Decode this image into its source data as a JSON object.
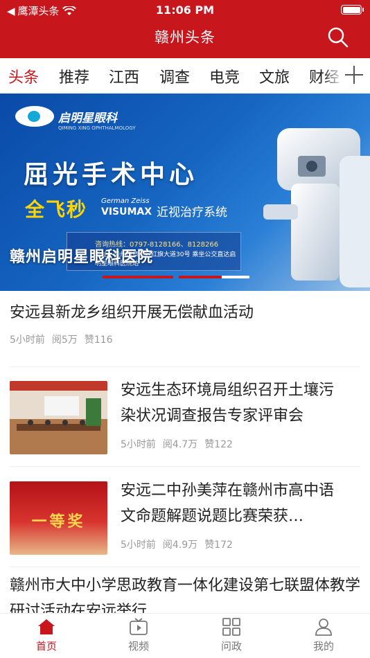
{
  "status_bar": {
    "back_app": "鹰潭头条",
    "time": "11:06 PM"
  },
  "header": {
    "title": "赣州头条"
  },
  "tabs": [
    {
      "label": "头条",
      "active": true
    },
    {
      "label": "推荐",
      "active": false
    },
    {
      "label": "江西",
      "active": false
    },
    {
      "label": "调查",
      "active": false
    },
    {
      "label": "电竞",
      "active": false
    },
    {
      "label": "文旅",
      "active": false
    },
    {
      "label": "财经",
      "active": false
    }
  ],
  "banner": {
    "logo_text": "启明星眼科",
    "logo_sub": "QIMING XING OPHTHALMOLOGY",
    "headline": "屈光手术中心",
    "subhead": "全飞秒",
    "brand_small": "German Zeiss",
    "brand": "VISUMAX",
    "system": "近视治疗系统",
    "contact": "咨询热线：0797-8128166、8128266",
    "address": "地址：赣州市章贡区红旗大道30号 乘坐公交直达启明星眼科医院站",
    "caption": "赣州启明星眼科医院",
    "slide_count": 3,
    "active_slide": 2
  },
  "feed": [
    {
      "title": "安远县新龙乡组织开展无偿献血活动",
      "time": "5小时前",
      "views": "阅5万",
      "likes": "赞116"
    },
    {
      "title": "安远生态环境局组织召开土壤污染状况调查报告专家评审会",
      "time": "5小时前",
      "views": "阅4.7万",
      "likes": "赞122"
    },
    {
      "title": "安远二中孙美萍在赣州市高中语文命题解题说题比赛荣获…",
      "time": "5小时前",
      "views": "阅4.9万",
      "likes": "赞172"
    },
    {
      "title": "赣州市大中小学思政教育一体化建设第七联盟体教学研讨活动在安远举行"
    }
  ],
  "thumb_captions": {
    "award": "一等奖"
  },
  "bottom_nav": [
    {
      "label": "首页",
      "icon": "home-icon",
      "active": true
    },
    {
      "label": "视频",
      "icon": "video-icon",
      "active": false
    },
    {
      "label": "问政",
      "icon": "grid-icon",
      "active": false
    },
    {
      "label": "我的",
      "icon": "user-icon",
      "active": false
    }
  ],
  "colors": {
    "brand_red": "#c8161d",
    "meta_gray": "#999999"
  }
}
